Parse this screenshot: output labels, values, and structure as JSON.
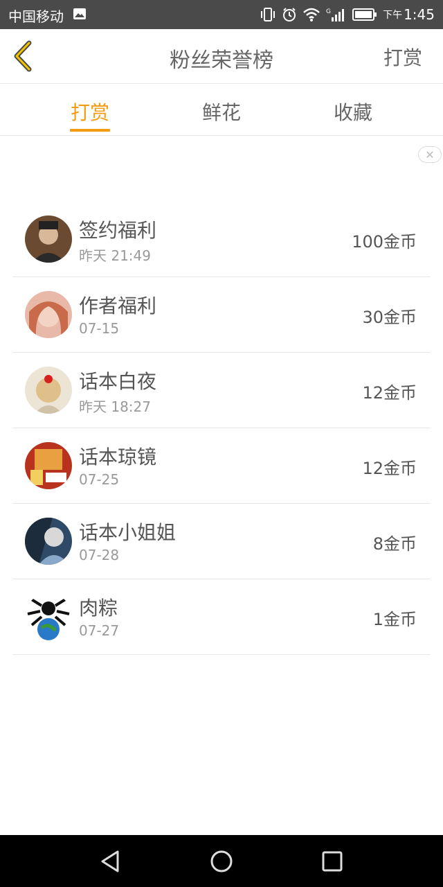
{
  "status_bar": {
    "carrier": "中国移动",
    "ampm": "下午",
    "time": "1:45"
  },
  "header": {
    "title": "粉丝荣誉榜",
    "action": "打赏"
  },
  "tabs": [
    {
      "label": "打赏",
      "active": true
    },
    {
      "label": "鲜花",
      "active": false
    },
    {
      "label": "收藏",
      "active": false
    }
  ],
  "fans": [
    {
      "name": "签约福利",
      "date": "昨天 21:49",
      "amount": "100金币",
      "avatar_color": "#5a3a2a"
    },
    {
      "name": "作者福利",
      "date": "07-15",
      "amount": "30金币",
      "avatar_color": "#d98a7a"
    },
    {
      "name": "话本白夜",
      "date": "昨天 18:27",
      "amount": "12金币",
      "avatar_color": "#e6d4b4"
    },
    {
      "name": "话本琼镜",
      "date": "07-25",
      "amount": "12金币",
      "avatar_color": "#c2402a"
    },
    {
      "name": "话本小姐姐",
      "date": "07-28",
      "amount": "8金币",
      "avatar_color": "#3b5b7a"
    },
    {
      "name": "肉粽",
      "date": "07-27",
      "amount": "1金币",
      "avatar_color": "#2a6aa8"
    }
  ],
  "colors": {
    "accent": "#f39c12",
    "status_bar": "#4a4a4a",
    "nav_bar": "#000000"
  }
}
